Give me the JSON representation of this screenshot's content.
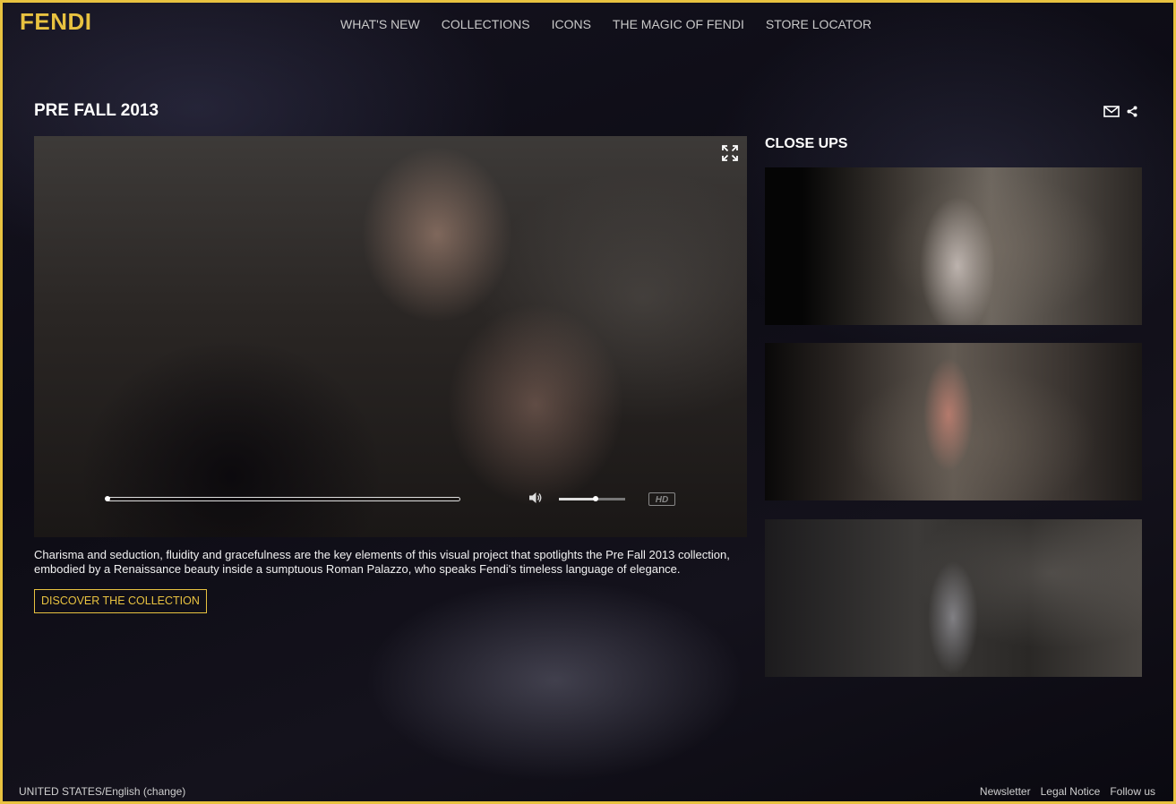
{
  "brand": {
    "logo_text": "FENDI",
    "accent_color": "#e8c240"
  },
  "nav": {
    "items": [
      {
        "label": "WHAT'S NEW"
      },
      {
        "label": "COLLECTIONS"
      },
      {
        "label": "ICONS"
      },
      {
        "label": "THE MAGIC OF FENDI"
      },
      {
        "label": "STORE LOCATOR"
      }
    ]
  },
  "page": {
    "title": "PRE FALL 2013"
  },
  "share": {
    "icons": [
      "mail-icon",
      "share-icon"
    ]
  },
  "video": {
    "progress": 0.0,
    "volume": 0.55,
    "hd_label": "HD",
    "icons": [
      "fullscreen-icon",
      "volume-icon"
    ]
  },
  "description": "Charisma and seduction, fluidity and gracefulness are the key elements of this visual project that spotlights the Pre Fall 2013 collection, embodied by a Renaissance beauty inside a sumptuous Roman Palazzo, who speaks Fendi's timeless language of elegance.",
  "cta": {
    "label": "DISCOVER THE COLLECTION"
  },
  "closeups": {
    "title": "CLOSE UPS",
    "count": 3
  },
  "footer": {
    "locale": "UNITED STATES/English (change)",
    "links": [
      "Newsletter",
      "Legal Notice",
      "Follow us"
    ]
  }
}
